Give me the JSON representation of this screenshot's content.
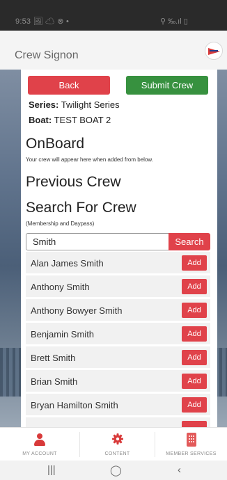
{
  "status_bar": {
    "time_and_icons": "9:53 🖼 ☁ ⊗ •",
    "right_icons": "⚲ ‰.ıl ▯"
  },
  "header": {
    "title": "Crew Signon"
  },
  "actions": {
    "back_label": "Back",
    "submit_label": "Submit Crew"
  },
  "meta": {
    "series_key": "Series:",
    "series_value": "Twilight Series",
    "boat_key": "Boat:",
    "boat_value": "TEST BOAT 2"
  },
  "onboard": {
    "heading": "OnBoard",
    "note": "Your crew will appear here when added from below."
  },
  "previous": {
    "heading": "Previous Crew"
  },
  "search": {
    "heading": "Search For Crew",
    "note": "(Membership and Daypass)",
    "value": "Smith",
    "button_label": "Search"
  },
  "results": [
    {
      "name": "Alan James Smith",
      "add_label": "Add"
    },
    {
      "name": "Anthony Smith",
      "add_label": "Add"
    },
    {
      "name": "Anthony Bowyer Smith",
      "add_label": "Add"
    },
    {
      "name": "Benjamin Smith",
      "add_label": "Add"
    },
    {
      "name": "Brett Smith",
      "add_label": "Add"
    },
    {
      "name": "Brian Smith",
      "add_label": "Add"
    },
    {
      "name": "Bryan Hamilton Smith",
      "add_label": "Add"
    }
  ],
  "bottom_nav": [
    {
      "label": "MY ACCOUNT",
      "icon": "person-icon"
    },
    {
      "label": "CONTENT",
      "icon": "gear-icon"
    },
    {
      "label": "MEMBER SERVICES",
      "icon": "member-services-icon"
    }
  ],
  "android_nav": {
    "recents": "|||",
    "home": "◯",
    "back": "‹"
  },
  "colors": {
    "accent_red": "#e0424a",
    "accent_green": "#37913f"
  }
}
